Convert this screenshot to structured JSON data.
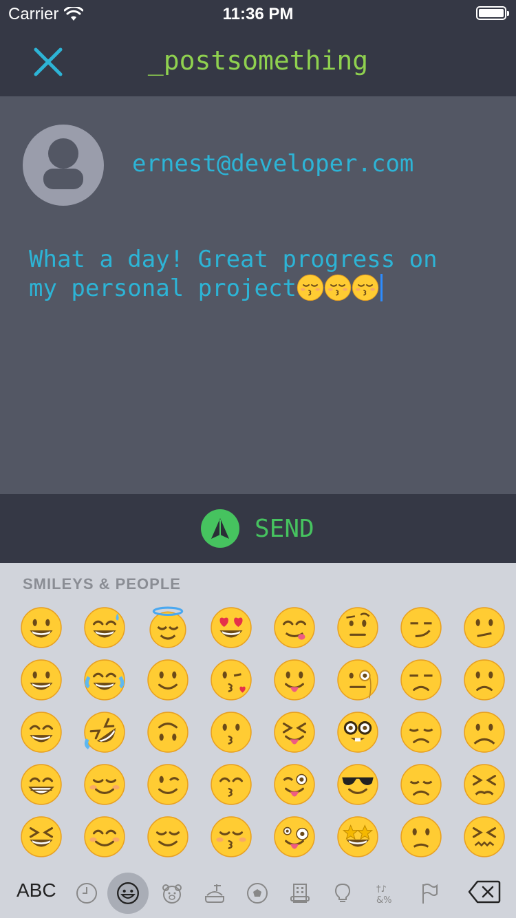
{
  "status_bar": {
    "carrier": "Carrier",
    "time": "11:36 PM",
    "wifi_icon": "wifi-icon",
    "battery_icon": "battery-icon"
  },
  "nav": {
    "close_icon": "close-icon",
    "title": "_postsomething",
    "accent_color": "#8fd14f"
  },
  "composer": {
    "avatar_icon": "user-avatar-icon",
    "email": "ernest@developer.com",
    "text": "What a day! Great progress on\nmy personal project",
    "trailing_emoji": [
      "kissing-closed-eyes",
      "kissing-closed-eyes",
      "kissing-closed-eyes"
    ],
    "text_color": "#2db4d6"
  },
  "send": {
    "icon": "send-arrow-icon",
    "label": "SEND",
    "color": "#46c35f"
  },
  "keyboard": {
    "category": "SMILEYS & PEOPLE",
    "emoji_rows": [
      [
        "grinning",
        "grinning-sweat",
        "innocent-halo",
        "heart-eyes",
        "yum",
        "raised-eyebrow",
        "smirk",
        "confused"
      ],
      [
        "smiley",
        "joy",
        "slight-smile",
        "kissing-heart",
        "tongue-out",
        "monocle",
        "unamused",
        "slight-frown"
      ],
      [
        "smile",
        "rofl",
        "upside-down",
        "kissing",
        "squint-tongue",
        "nerd",
        "disappointed",
        "frowning"
      ],
      [
        "grin",
        "blush-relaxed",
        "wink",
        "kissing-smiling-eyes",
        "wink-tongue",
        "sunglasses",
        "pensive",
        "persevere"
      ],
      [
        "laughing",
        "blush",
        "relieved",
        "kissing-closed-eyes",
        "zany",
        "star-struck",
        "worried",
        "confounded"
      ]
    ],
    "abc_label": "ABC",
    "tabs": [
      "recent-clock-icon",
      "smiley-icon",
      "animal-bear-icon",
      "food-icon",
      "sports-ball-icon",
      "travel-building-icon",
      "objects-bulb-icon",
      "symbols-icon",
      "flag-icon"
    ],
    "active_tab": "smiley-icon",
    "delete_icon": "backspace-icon"
  }
}
